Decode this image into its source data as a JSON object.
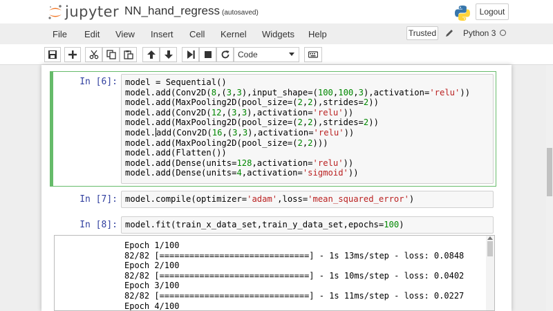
{
  "header": {
    "logo_text": "jupyter",
    "notebook_name": "NN_hand_regress",
    "save_status": "(autosaved)",
    "logout_label": "Logout"
  },
  "menubar": {
    "items": [
      "File",
      "Edit",
      "View",
      "Insert",
      "Cell",
      "Kernel",
      "Widgets",
      "Help"
    ],
    "trusted_label": "Trusted",
    "kernel_name": "Python 3"
  },
  "toolbar": {
    "buttons": [
      "save-icon",
      "plus-icon",
      "cut-icon",
      "copy-icon",
      "paste-icon",
      "arrow-up-icon",
      "arrow-down-icon",
      "step-forward-icon",
      "stop-icon",
      "restart-icon",
      "keyboard-icon"
    ],
    "cell_type": "Code"
  },
  "cells": [
    {
      "prompt": "In [6]:",
      "lines": [
        "model = Sequential()",
        "model.add(Conv2D(8,(3,3),input_shape=(100,100,3),activation='relu'))",
        "model.add(MaxPooling2D(pool_size=(2,2),strides=2))",
        "model.add(Conv2D(12,(3,3),activation='relu'))",
        "model.add(MaxPooling2D(pool_size=(2,2),strides=2))",
        "model.add(Conv2D(16,(3,3),activation='relu'))",
        "model.add(MaxPooling2D(pool_size=(2,2)))",
        "model.add(Flatten())",
        "model.add(Dense(units=128,activation='relu'))",
        "model.add(Dense(units=4,activation='sigmoid'))"
      ]
    },
    {
      "prompt": "In [7]:",
      "lines": [
        "model.compile(optimizer='adam',loss='mean_squared_error')"
      ]
    },
    {
      "prompt": "In [8]:",
      "lines": [
        "model.fit(train_x_data_set,train_y_data_set,epochs=100)"
      ]
    }
  ],
  "output": {
    "lines": [
      "Epoch 1/100",
      "82/82 [==============================] - 1s 13ms/step - loss: 0.0848",
      "Epoch 2/100",
      "82/82 [==============================] - 1s 10ms/step - loss: 0.0402",
      "Epoch 3/100",
      "82/82 [==============================] - 1s 11ms/step - loss: 0.0227",
      "Epoch 4/100"
    ]
  },
  "colors": {
    "selected_cell_border": "#66bb6a",
    "prompt_color": "#303f9f",
    "number_color": "#008800",
    "string_color": "#ba2121"
  }
}
